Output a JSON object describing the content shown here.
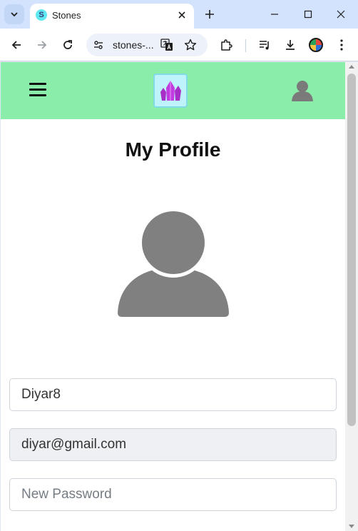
{
  "browser": {
    "tab_title": "Stones",
    "favicon_letter": "S",
    "url_display": "stones-...",
    "icons": {
      "tab_search": "chevron-down-icon",
      "tab_close": "close-icon",
      "new_tab": "plus-icon",
      "minimize": "minimize-icon",
      "maximize": "maximize-icon",
      "close_window": "close-icon",
      "back": "back-arrow-icon",
      "forward": "forward-arrow-icon",
      "reload": "reload-icon",
      "site_info": "tune-icon",
      "translate": "translate-icon",
      "bookmark": "star-icon",
      "extensions": "puzzle-icon",
      "media": "media-playlist-icon",
      "downloads": "download-icon",
      "profile": "profile-avatar-icon",
      "menu": "more-vertical-icon"
    }
  },
  "app": {
    "header_color": "#8aeeaa",
    "icons": {
      "menu": "hamburger-menu-icon",
      "logo": "crystal-logo",
      "user": "user-icon"
    },
    "page_title": "My Profile",
    "avatar_icon": "user-avatar-icon",
    "form": {
      "username_value": "Diyar8",
      "email_value": "diyar@gmail.com",
      "password_placeholder": "New Password"
    }
  }
}
